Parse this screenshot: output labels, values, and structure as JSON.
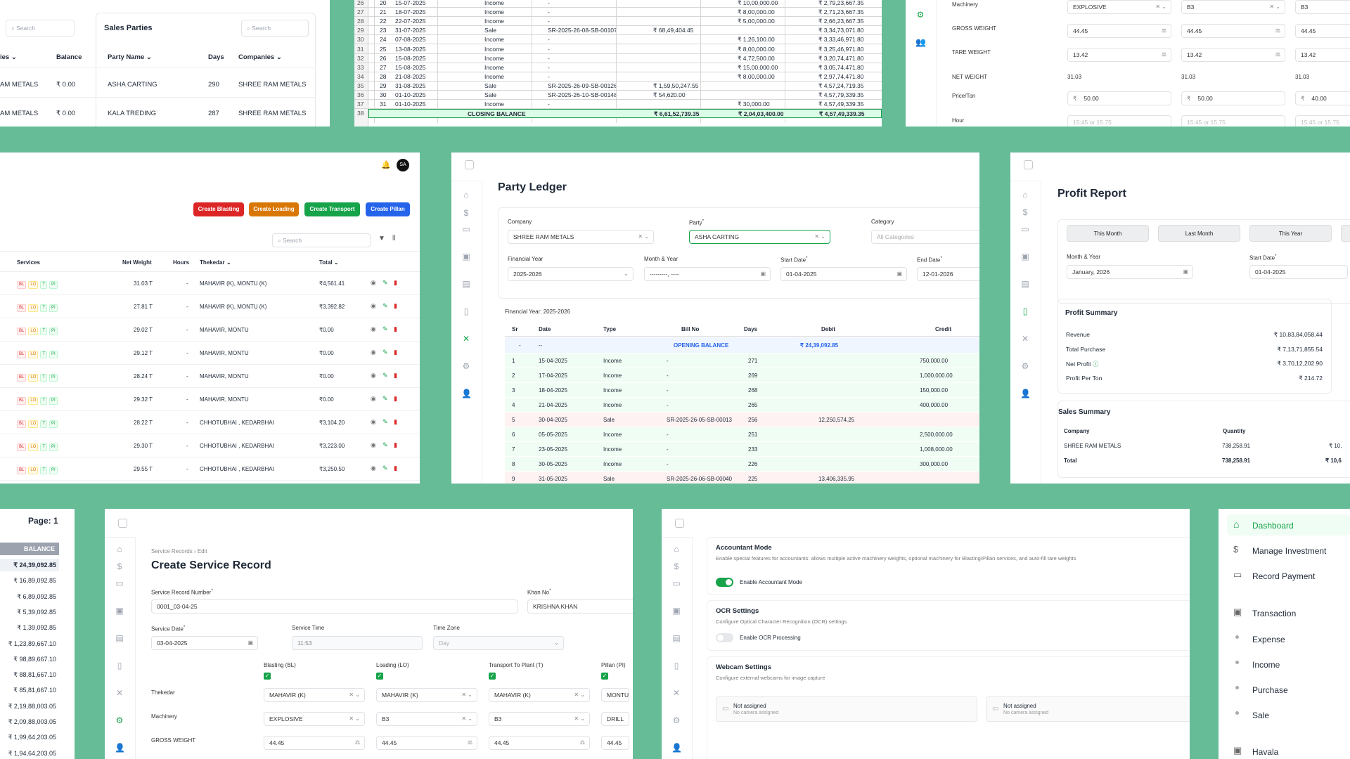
{
  "p1": {
    "search_left": "Search",
    "title": "Sales Parties",
    "search": "Search",
    "h_ies": "ies",
    "h_balance": "Balance",
    "h_party": "Party Name",
    "h_days": "Days",
    "h_companies": "Companies",
    "rows": [
      {
        "ies": "AM METALS",
        "balance": "₹ 0.00",
        "party": "ASHA CARTING",
        "days": "290",
        "company": "SHREE RAM METALS"
      },
      {
        "ies": "AM METALS",
        "balance": "₹ 0.00",
        "party": "KALA TREDING",
        "days": "287",
        "company": "SHREE RAM METALS"
      }
    ]
  },
  "p2": {
    "rows": [
      {
        "n": "26",
        "sr": "20",
        "date": "15-07-2025",
        "type": "Income",
        "bill": "-",
        "debit": "",
        "credit": "₹ 10,00,000.00",
        "bal": "₹ 2,79,23,667.35"
      },
      {
        "n": "27",
        "sr": "21",
        "date": "18-07-2025",
        "type": "Income",
        "bill": "-",
        "debit": "",
        "credit": "₹ 8,00,000.00",
        "bal": "₹ 2,71,23,667.35"
      },
      {
        "n": "28",
        "sr": "22",
        "date": "22-07-2025",
        "type": "Income",
        "bill": "-",
        "debit": "",
        "credit": "₹ 5,00,000.00",
        "bal": "₹ 2,66,23,667.35"
      },
      {
        "n": "29",
        "sr": "23",
        "date": "31-07-2025",
        "type": "Sale",
        "bill": "SR-2025-26-08-SB-00107",
        "debit": "₹ 68,49,404.45",
        "credit": "",
        "bal": "₹ 3,34,73,071.80"
      },
      {
        "n": "30",
        "sr": "24",
        "date": "07-08-2025",
        "type": "Income",
        "bill": "-",
        "debit": "",
        "credit": "₹ 1,26,100.00",
        "bal": "₹ 3,33,46,971.80"
      },
      {
        "n": "31",
        "sr": "25",
        "date": "13-08-2025",
        "type": "Income",
        "bill": "-",
        "debit": "",
        "credit": "₹ 8,00,000.00",
        "bal": "₹ 3,25,46,971.80"
      },
      {
        "n": "32",
        "sr": "26",
        "date": "15-08-2025",
        "type": "Income",
        "bill": "-",
        "debit": "",
        "credit": "₹ 4,72,500.00",
        "bal": "₹ 3,20,74,471.80"
      },
      {
        "n": "33",
        "sr": "27",
        "date": "15-08-2025",
        "type": "Income",
        "bill": "-",
        "debit": "",
        "credit": "₹ 15,00,000.00",
        "bal": "₹ 3,05,74,471.80"
      },
      {
        "n": "34",
        "sr": "28",
        "date": "21-08-2025",
        "type": "Income",
        "bill": "-",
        "debit": "",
        "credit": "₹ 8,00,000.00",
        "bal": "₹ 2,97,74,471.80"
      },
      {
        "n": "35",
        "sr": "29",
        "date": "31-08-2025",
        "type": "Sale",
        "bill": "SR-2025-26-09-SB-00126",
        "debit": "₹ 1,59,50,247.55",
        "credit": "",
        "bal": "₹ 4,57,24,719.35"
      },
      {
        "n": "36",
        "sr": "30",
        "date": "01-10-2025",
        "type": "Sale",
        "bill": "SR-2025-26-10-SB-00148",
        "debit": "₹ 54,620.00",
        "credit": "",
        "bal": "₹ 4,57,79,339.35"
      },
      {
        "n": "37",
        "sr": "31",
        "date": "01-10-2025",
        "type": "Income",
        "bill": "-",
        "debit": "",
        "credit": "₹ 30,000.00",
        "bal": "₹ 4,57,49,339.35"
      }
    ],
    "closing_n": "38",
    "closing_label": "CLOSING BALANCE",
    "closing_debit": "₹ 6,61,52,739.35",
    "closing_credit": "₹ 2,04,03,400.00",
    "closing_bal": "₹ 4,57,49,339.35"
  },
  "p3": {
    "labels": [
      "Machinery",
      "GROSS WEIGHT",
      "TARE WEIGHT",
      "NET WEIGHT",
      "Price/Ton",
      "Hour"
    ],
    "col1": {
      "mach": "EXPLOSIVE",
      "gross": "44.45",
      "tare": "13.42",
      "net": "31.03",
      "price": "50.00",
      "hour": "15:45 or 15.75"
    },
    "col2": {
      "mach": "B3",
      "gross": "44.45",
      "tare": "13.42",
      "net": "31.03",
      "price": "50.00",
      "hour": "15:45 or 15.75"
    },
    "col3": {
      "mach": "B3",
      "gross": "44.45",
      "tare": "13.42",
      "net": "31.03",
      "price": "40.00",
      "hour": "15:45 or 15.75"
    },
    "rupee": "₹"
  },
  "p4": {
    "avatar": "SA",
    "btn_blasting": "Create Blasting",
    "btn_loading": "Create Loading",
    "btn_transport": "Create Transport",
    "btn_pillan": "Create Pillan",
    "search": "Search",
    "h_services": "Services",
    "h_net": "Net Weight",
    "h_hours": "Hours",
    "h_thekedar": "Thekedar",
    "h_total": "Total",
    "badges": [
      "BL",
      "LO",
      "T",
      "PI"
    ],
    "rows": [
      {
        "net": "31.03 T",
        "hours": "-",
        "thekedar": "MAHAVIR (K), MONTU (K)",
        "total": "₹4,561.41"
      },
      {
        "net": "27.81 T",
        "hours": "-",
        "thekedar": "MAHAVIR (K), MONTU (K)",
        "total": "₹3,392.82"
      },
      {
        "net": "29.02 T",
        "hours": "-",
        "thekedar": "MAHAVIR, MONTU",
        "total": "₹0.00"
      },
      {
        "net": "29.12 T",
        "hours": "-",
        "thekedar": "MAHAVIR, MONTU",
        "total": "₹0.00"
      },
      {
        "net": "28.24 T",
        "hours": "-",
        "thekedar": "MAHAVIR, MONTU",
        "total": "₹0.00"
      },
      {
        "net": "29.32 T",
        "hours": "-",
        "thekedar": "MAHAVIR, MONTU",
        "total": "₹0.00"
      },
      {
        "net": "28.22 T",
        "hours": "-",
        "thekedar": "CHHOTUBHAI , KEDARBHAI",
        "total": "₹3,104.20"
      },
      {
        "net": "29.30 T",
        "hours": "-",
        "thekedar": "CHHOTUBHAI , KEDARBHAI",
        "total": "₹3,223.00"
      },
      {
        "net": "29.55 T",
        "hours": "-",
        "thekedar": "CHHOTUBHAI , KEDARBHAI",
        "total": "₹3,250.50"
      }
    ]
  },
  "p5": {
    "title": "Party Ledger",
    "l_company": "Company",
    "v_company": "SHREE RAM METALS",
    "l_party": "Party",
    "v_party": "ASHA CARTING",
    "l_category": "Category",
    "ph_category": "All Categories",
    "l_fy": "Financial Year",
    "v_fy": "2025-2026",
    "l_my": "Month & Year",
    "v_my": "---------, ----",
    "l_start": "Start Date",
    "v_start": "01-04-2025",
    "l_end": "End Date",
    "v_end": "12-01-2026",
    "fy_caption": "Financial Year: 2025-2026",
    "h": [
      "Sr",
      "Date",
      "Type",
      "Bill No",
      "Days",
      "Debit",
      "Credit"
    ],
    "opening": {
      "sr": "-",
      "date": "--",
      "label": "OPENING BALANCE",
      "debit": "₹ 24,39,092.85"
    },
    "rows": [
      {
        "sr": "1",
        "date": "15-04-2025",
        "type": "Income",
        "bill": "-",
        "days": "271",
        "debit": "",
        "credit": "750,000.00"
      },
      {
        "sr": "2",
        "date": "17-04-2025",
        "type": "Income",
        "bill": "-",
        "days": "269",
        "debit": "",
        "credit": "1,000,000.00"
      },
      {
        "sr": "3",
        "date": "18-04-2025",
        "type": "Income",
        "bill": "-",
        "days": "268",
        "debit": "",
        "credit": "150,000.00"
      },
      {
        "sr": "4",
        "date": "21-04-2025",
        "type": "Income",
        "bill": "-",
        "days": "265",
        "debit": "",
        "credit": "400,000.00"
      },
      {
        "sr": "5",
        "date": "30-04-2025",
        "type": "Sale",
        "bill": "SR-2025-26-05-SB-00013",
        "days": "256",
        "debit": "12,250,574.25",
        "credit": ""
      },
      {
        "sr": "6",
        "date": "05-05-2025",
        "type": "Income",
        "bill": "-",
        "days": "251",
        "debit": "",
        "credit": "2,500,000.00"
      },
      {
        "sr": "7",
        "date": "23-05-2025",
        "type": "Income",
        "bill": "-",
        "days": "233",
        "debit": "",
        "credit": "1,008,000.00"
      },
      {
        "sr": "8",
        "date": "30-05-2025",
        "type": "Income",
        "bill": "-",
        "days": "226",
        "debit": "",
        "credit": "300,000.00"
      },
      {
        "sr": "9",
        "date": "31-05-2025",
        "type": "Sale",
        "bill": "SR-2025-26-06-SB-00040",
        "days": "225",
        "debit": "13,406,335.95",
        "credit": ""
      }
    ]
  },
  "p6": {
    "title": "Profit Report",
    "btn_this_month": "This Month",
    "btn_last_month": "Last Month",
    "btn_this_year": "This Year",
    "l_my": "Month & Year",
    "v_my": "January, 2026",
    "l_start": "Start Date",
    "v_start": "01-04-2025",
    "profit_title": "Profit Summary",
    "revenue_l": "Revenue",
    "revenue_v": "₹ 10,83,84,058.44",
    "purchase_l": "Total Purchase",
    "purchase_v": "₹ 7,13,71,855.54",
    "net_l": "Net Profit",
    "net_v": "₹ 3,70,12,202.90",
    "pt_l": "Profit Per Ton",
    "pt_v": "₹ 214.72",
    "sales_title": "Sales Summary",
    "h_company": "Company",
    "h_qty": "Quantity",
    "r_company": "SHREE RAM METALS",
    "r_qty": "738,258.91",
    "r_amt": "₹ 10,",
    "t_label": "Total",
    "t_qty": "738,258.91",
    "t_amt": "₹ 10,6"
  },
  "p7": {
    "page": "Page: 1",
    "h_balance": "BALANCE",
    "rows": [
      "₹ 24,39,092.85",
      "₹ 16,89,092.85",
      "₹ 6,89,092.85",
      "₹ 5,39,092.85",
      "₹ 1,39,092.85",
      "₹ 1,23,89,667.10",
      "₹ 98,89,667.10",
      "₹ 88,81,667.10",
      "₹ 85,81,667.10",
      "₹ 2,19,88,003.05",
      "₹ 2,09,88,003.05",
      "₹ 1,99,64,203.05",
      "₹ 1,94,64,203.05"
    ]
  },
  "p8": {
    "crumb1": "Service Records",
    "crumb2": "Edit",
    "title": "Create Service Record",
    "l_srn": "Service Record Number",
    "v_srn": "0001_03-04-25",
    "l_khan": "Khan No",
    "v_khan": "KRISHNA KHAN",
    "l_date": "Service Date",
    "v_date": "03-04-2025",
    "l_time": "Service Time",
    "v_time": "11:53",
    "l_tz": "Time Zone",
    "v_tz": "Day",
    "l_bl": "Blasting (BL)",
    "l_lo": "Loading (LO)",
    "l_t": "Transport To Plant (T)",
    "l_pi": "Pillan (PI)",
    "l_thekedar": "Thekedar",
    "l_machinery": "Machinery",
    "l_gross": "GROSS WEIGHT",
    "thekedar": [
      "MAHAVIR (K)",
      "MAHAVIR (K)",
      "MAHAVIR (K)",
      "MONTU ("
    ],
    "machinery": [
      "EXPLOSIVE",
      "B3",
      "B3",
      "DRILL"
    ],
    "gross": [
      "44.45",
      "44.45",
      "44.45",
      "44.45"
    ]
  },
  "p9": {
    "acc_title": "Accountant Mode",
    "acc_desc": "Enable special features for accountants: allows multiple active machinery weights, optional machinery for Blasting/Pillan services, and auto-fill tare weights",
    "acc_toggle": "Enable Accountant Mode",
    "ocr_title": "OCR Settings",
    "ocr_desc": "Configure Optical Character Recognition (OCR) settings",
    "ocr_toggle": "Enable OCR Processing",
    "web_title": "Webcam Settings",
    "web_desc": "Configure external webcams for image capture",
    "cam1": "Not assigned",
    "cam1_sub": "No camera assigned",
    "cam2": "Not assigned",
    "cam2_sub": "No camera assigned"
  },
  "p10": {
    "items": [
      "Dashboard",
      "Manage Investment",
      "Record Payment",
      "Transaction",
      "Expense",
      "Income",
      "Purchase",
      "Sale",
      "Havala"
    ]
  },
  "colors": {
    "accent": "#16a34a",
    "bg": "#67bc98",
    "blasting": "#dc2626",
    "loading": "#d97706",
    "transport": "#16a34a",
    "pillan": "#2563eb"
  }
}
